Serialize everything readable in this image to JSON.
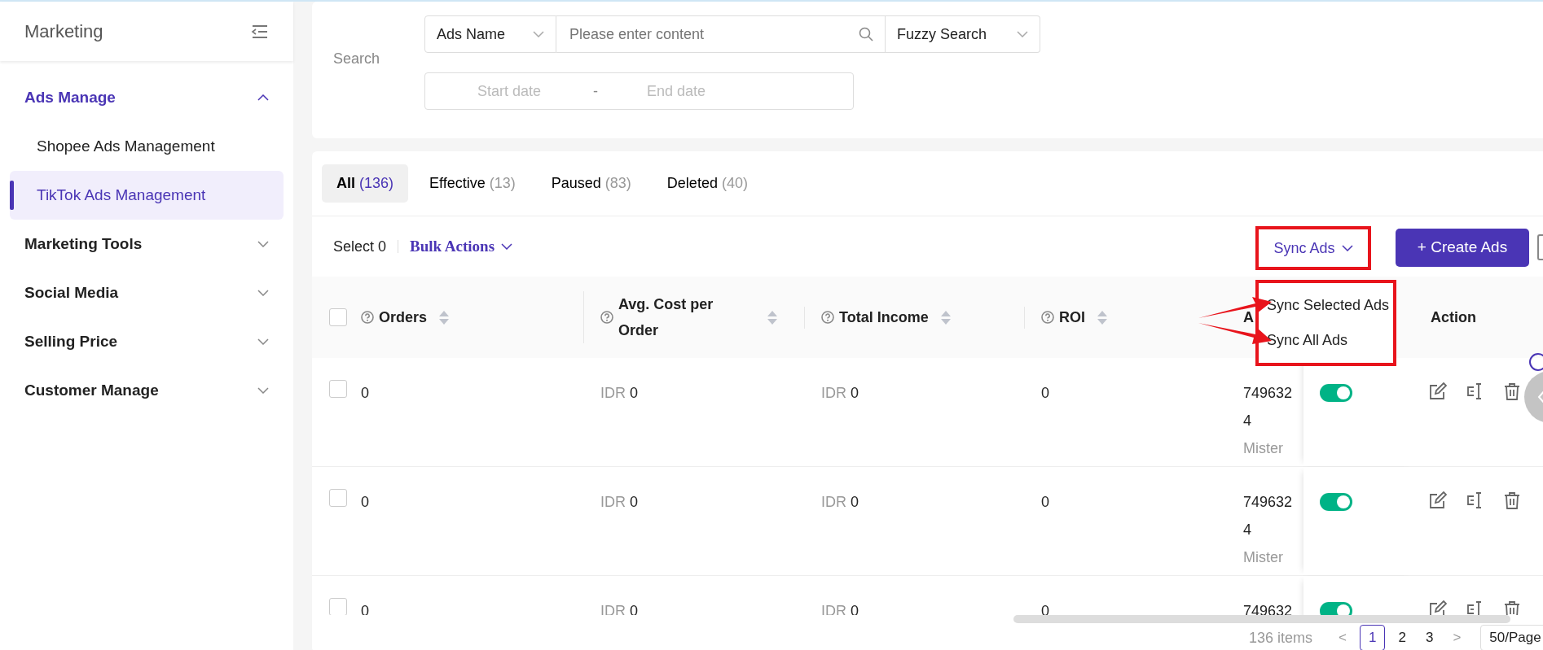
{
  "sidebar": {
    "title": "Marketing",
    "groups": [
      {
        "label": "Ads Manage",
        "expanded": true,
        "children": [
          {
            "label": "Shopee Ads Management",
            "selected": false
          },
          {
            "label": "TikTok Ads Management",
            "selected": true
          }
        ]
      },
      {
        "label": "Marketing Tools",
        "expanded": false
      },
      {
        "label": "Social Media",
        "expanded": false
      },
      {
        "label": "Selling Price",
        "expanded": false
      },
      {
        "label": "Customer Manage",
        "expanded": false
      }
    ]
  },
  "search": {
    "label": "Search",
    "field_type": "Ads Name",
    "placeholder": "Please enter content",
    "match_mode": "Fuzzy Search",
    "start_placeholder": "Start date",
    "separator": "-",
    "end_placeholder": "End date"
  },
  "tabs": [
    {
      "label": "All",
      "count": "(136)",
      "selected": true
    },
    {
      "label": "Effective",
      "count": "(13)",
      "selected": false
    },
    {
      "label": "Paused",
      "count": "(83)",
      "selected": false
    },
    {
      "label": "Deleted",
      "count": "(40)",
      "selected": false
    }
  ],
  "toolbar": {
    "select_label": "Select 0",
    "bulk_actions": "Bulk Actions",
    "sync_button": "Sync Ads",
    "sync_menu": {
      "open": true,
      "items": [
        "Sync Selected Ads",
        "Sync All Ads"
      ]
    },
    "create_button": "+ Create Ads"
  },
  "table": {
    "all_checked": false,
    "columns": [
      {
        "label": "Orders"
      },
      {
        "label": "Avg. Cost per Order"
      },
      {
        "label": "Total Income"
      },
      {
        "label": "ROI"
      },
      {
        "label": "A"
      }
    ],
    "action_header": "Action",
    "rows": [
      {
        "checked": false,
        "orders": "0",
        "avg_cost": {
          "currency": "IDR",
          "amount": "0"
        },
        "total_income": {
          "currency": "IDR",
          "amount": "0"
        },
        "roi": "0",
        "ad_lines": [
          "749632",
          "4"
        ],
        "ad_owner": "Mister",
        "enabled": true
      },
      {
        "checked": false,
        "orders": "0",
        "avg_cost": {
          "currency": "IDR",
          "amount": "0"
        },
        "total_income": {
          "currency": "IDR",
          "amount": "0"
        },
        "roi": "0",
        "ad_lines": [
          "749632",
          "4"
        ],
        "ad_owner": "Mister",
        "enabled": true
      },
      {
        "checked": false,
        "orders": "0",
        "avg_cost": {
          "currency": "IDR",
          "amount": "0"
        },
        "total_income": {
          "currency": "IDR",
          "amount": "0"
        },
        "roi": "0",
        "ad_lines": [
          "749632"
        ],
        "enabled": true
      }
    ]
  },
  "pagination": {
    "total": "136 items",
    "prev": "<",
    "pages": [
      {
        "label": "1",
        "selected": true
      },
      {
        "label": "2",
        "selected": false
      },
      {
        "label": "3",
        "selected": false
      }
    ],
    "next": ">",
    "page_size": "50/Page"
  }
}
